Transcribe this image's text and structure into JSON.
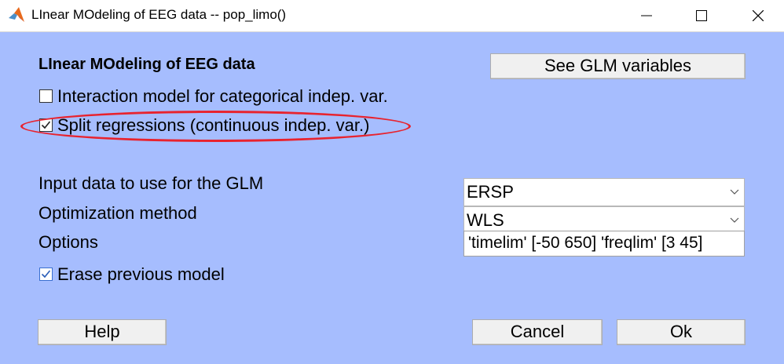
{
  "window": {
    "title": "LInear MOdeling of EEG data -- pop_limo()"
  },
  "dialog": {
    "heading": "LInear MOdeling of EEG data",
    "see_glm_button": "See GLM variables",
    "interaction_checkbox": {
      "label": "Interaction model for categorical indep. var.",
      "checked": false
    },
    "split_checkbox": {
      "label": "Split regressions (continuous indep. var.)",
      "checked": true
    },
    "input_data_label": "Input data to use for the GLM",
    "input_data_value": "ERSP",
    "optimization_label": "Optimization method",
    "optimization_value": "WLS",
    "options_label": "Options",
    "options_value": "'timelim' [-50 650] 'freqlim' [3 45]",
    "erase_checkbox": {
      "label": "Erase previous model",
      "checked": true
    },
    "help_button": "Help",
    "cancel_button": "Cancel",
    "ok_button": "Ok"
  },
  "colors": {
    "background": "#a6bdfe",
    "highlight": "#e8232e"
  },
  "icons": {
    "app": "matlab-icon",
    "minimize": "minimize-icon",
    "maximize": "maximize-icon",
    "close": "close-icon"
  }
}
